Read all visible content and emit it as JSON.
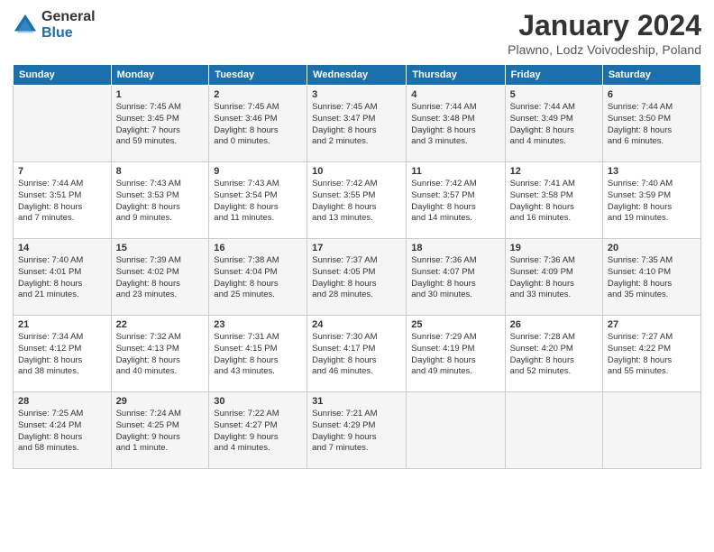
{
  "header": {
    "logo_general": "General",
    "logo_blue": "Blue",
    "title": "January 2024",
    "subtitle": "Plawno, Lodz Voivodeship, Poland"
  },
  "days_of_week": [
    "Sunday",
    "Monday",
    "Tuesday",
    "Wednesday",
    "Thursday",
    "Friday",
    "Saturday"
  ],
  "weeks": [
    [
      {
        "day": "",
        "details": []
      },
      {
        "day": "1",
        "details": [
          "Sunrise: 7:45 AM",
          "Sunset: 3:45 PM",
          "Daylight: 7 hours",
          "and 59 minutes."
        ]
      },
      {
        "day": "2",
        "details": [
          "Sunrise: 7:45 AM",
          "Sunset: 3:46 PM",
          "Daylight: 8 hours",
          "and 0 minutes."
        ]
      },
      {
        "day": "3",
        "details": [
          "Sunrise: 7:45 AM",
          "Sunset: 3:47 PM",
          "Daylight: 8 hours",
          "and 2 minutes."
        ]
      },
      {
        "day": "4",
        "details": [
          "Sunrise: 7:44 AM",
          "Sunset: 3:48 PM",
          "Daylight: 8 hours",
          "and 3 minutes."
        ]
      },
      {
        "day": "5",
        "details": [
          "Sunrise: 7:44 AM",
          "Sunset: 3:49 PM",
          "Daylight: 8 hours",
          "and 4 minutes."
        ]
      },
      {
        "day": "6",
        "details": [
          "Sunrise: 7:44 AM",
          "Sunset: 3:50 PM",
          "Daylight: 8 hours",
          "and 6 minutes."
        ]
      }
    ],
    [
      {
        "day": "7",
        "details": [
          "Sunrise: 7:44 AM",
          "Sunset: 3:51 PM",
          "Daylight: 8 hours",
          "and 7 minutes."
        ]
      },
      {
        "day": "8",
        "details": [
          "Sunrise: 7:43 AM",
          "Sunset: 3:53 PM",
          "Daylight: 8 hours",
          "and 9 minutes."
        ]
      },
      {
        "day": "9",
        "details": [
          "Sunrise: 7:43 AM",
          "Sunset: 3:54 PM",
          "Daylight: 8 hours",
          "and 11 minutes."
        ]
      },
      {
        "day": "10",
        "details": [
          "Sunrise: 7:42 AM",
          "Sunset: 3:55 PM",
          "Daylight: 8 hours",
          "and 13 minutes."
        ]
      },
      {
        "day": "11",
        "details": [
          "Sunrise: 7:42 AM",
          "Sunset: 3:57 PM",
          "Daylight: 8 hours",
          "and 14 minutes."
        ]
      },
      {
        "day": "12",
        "details": [
          "Sunrise: 7:41 AM",
          "Sunset: 3:58 PM",
          "Daylight: 8 hours",
          "and 16 minutes."
        ]
      },
      {
        "day": "13",
        "details": [
          "Sunrise: 7:40 AM",
          "Sunset: 3:59 PM",
          "Daylight: 8 hours",
          "and 19 minutes."
        ]
      }
    ],
    [
      {
        "day": "14",
        "details": [
          "Sunrise: 7:40 AM",
          "Sunset: 4:01 PM",
          "Daylight: 8 hours",
          "and 21 minutes."
        ]
      },
      {
        "day": "15",
        "details": [
          "Sunrise: 7:39 AM",
          "Sunset: 4:02 PM",
          "Daylight: 8 hours",
          "and 23 minutes."
        ]
      },
      {
        "day": "16",
        "details": [
          "Sunrise: 7:38 AM",
          "Sunset: 4:04 PM",
          "Daylight: 8 hours",
          "and 25 minutes."
        ]
      },
      {
        "day": "17",
        "details": [
          "Sunrise: 7:37 AM",
          "Sunset: 4:05 PM",
          "Daylight: 8 hours",
          "and 28 minutes."
        ]
      },
      {
        "day": "18",
        "details": [
          "Sunrise: 7:36 AM",
          "Sunset: 4:07 PM",
          "Daylight: 8 hours",
          "and 30 minutes."
        ]
      },
      {
        "day": "19",
        "details": [
          "Sunrise: 7:36 AM",
          "Sunset: 4:09 PM",
          "Daylight: 8 hours",
          "and 33 minutes."
        ]
      },
      {
        "day": "20",
        "details": [
          "Sunrise: 7:35 AM",
          "Sunset: 4:10 PM",
          "Daylight: 8 hours",
          "and 35 minutes."
        ]
      }
    ],
    [
      {
        "day": "21",
        "details": [
          "Sunrise: 7:34 AM",
          "Sunset: 4:12 PM",
          "Daylight: 8 hours",
          "and 38 minutes."
        ]
      },
      {
        "day": "22",
        "details": [
          "Sunrise: 7:32 AM",
          "Sunset: 4:13 PM",
          "Daylight: 8 hours",
          "and 40 minutes."
        ]
      },
      {
        "day": "23",
        "details": [
          "Sunrise: 7:31 AM",
          "Sunset: 4:15 PM",
          "Daylight: 8 hours",
          "and 43 minutes."
        ]
      },
      {
        "day": "24",
        "details": [
          "Sunrise: 7:30 AM",
          "Sunset: 4:17 PM",
          "Daylight: 8 hours",
          "and 46 minutes."
        ]
      },
      {
        "day": "25",
        "details": [
          "Sunrise: 7:29 AM",
          "Sunset: 4:19 PM",
          "Daylight: 8 hours",
          "and 49 minutes."
        ]
      },
      {
        "day": "26",
        "details": [
          "Sunrise: 7:28 AM",
          "Sunset: 4:20 PM",
          "Daylight: 8 hours",
          "and 52 minutes."
        ]
      },
      {
        "day": "27",
        "details": [
          "Sunrise: 7:27 AM",
          "Sunset: 4:22 PM",
          "Daylight: 8 hours",
          "and 55 minutes."
        ]
      }
    ],
    [
      {
        "day": "28",
        "details": [
          "Sunrise: 7:25 AM",
          "Sunset: 4:24 PM",
          "Daylight: 8 hours",
          "and 58 minutes."
        ]
      },
      {
        "day": "29",
        "details": [
          "Sunrise: 7:24 AM",
          "Sunset: 4:25 PM",
          "Daylight: 9 hours",
          "and 1 minute."
        ]
      },
      {
        "day": "30",
        "details": [
          "Sunrise: 7:22 AM",
          "Sunset: 4:27 PM",
          "Daylight: 9 hours",
          "and 4 minutes."
        ]
      },
      {
        "day": "31",
        "details": [
          "Sunrise: 7:21 AM",
          "Sunset: 4:29 PM",
          "Daylight: 9 hours",
          "and 7 minutes."
        ]
      },
      {
        "day": "",
        "details": []
      },
      {
        "day": "",
        "details": []
      },
      {
        "day": "",
        "details": []
      }
    ]
  ]
}
